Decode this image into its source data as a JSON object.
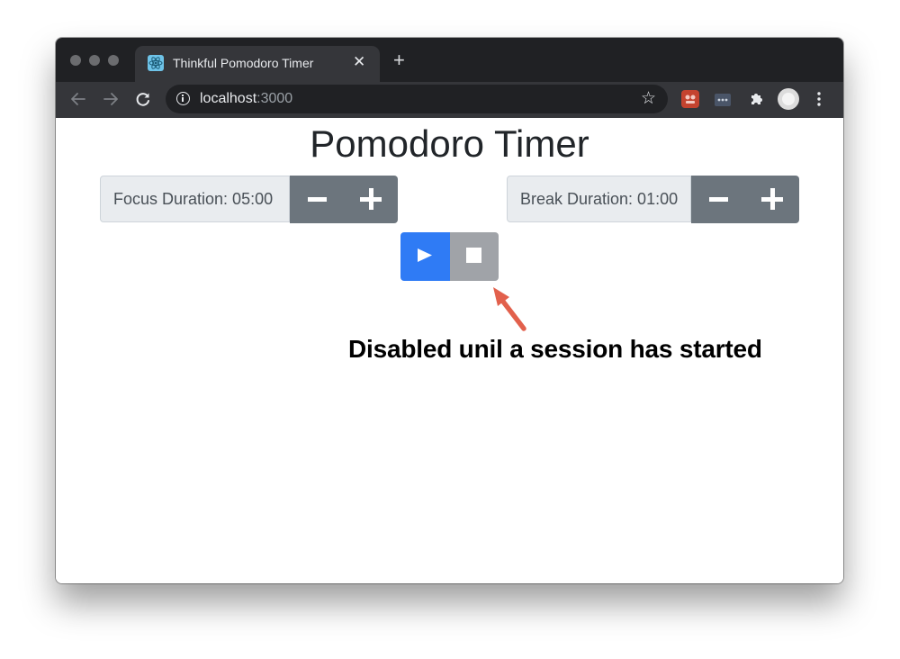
{
  "browser": {
    "tab": {
      "title": "Thinkful Pomodoro Timer"
    },
    "address_bar": {
      "host": "localhost",
      "port": ":3000"
    }
  },
  "page": {
    "title": "Pomodoro Timer",
    "focus": {
      "label": "Focus Duration: 05:00"
    },
    "break": {
      "label": "Break Duration: 01:00"
    },
    "stop_disabled": true,
    "annotation": "Disabled unil a session has started"
  },
  "colors": {
    "primary": "#2f7bf5",
    "secondary": "#6c757d",
    "disabled": "#a0a3a8",
    "arrow": "#e2604c"
  }
}
